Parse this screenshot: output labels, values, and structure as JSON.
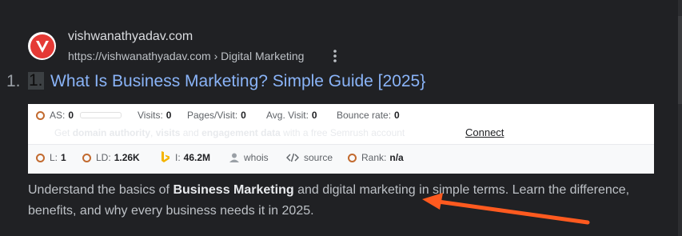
{
  "site": {
    "name": "vishwanathyadav.com",
    "url": "https://vishwanathyadav.com",
    "breadcrumb_sep": "›",
    "breadcrumb": "Digital Marketing",
    "logo_icon": "v-logo-icon",
    "more_icon": "three-dot-menu-icon"
  },
  "result": {
    "number_outer": "1.",
    "number_inner": "1.",
    "title": "What Is Business Marketing? Simple Guide [2025}"
  },
  "seo": {
    "as_label": "AS:",
    "as_value": "0",
    "visits_label": "Visits:",
    "visits_value": "0",
    "pages_label": "Pages/Visit:",
    "pages_value": "0",
    "avg_label": "Avg. Visit:",
    "avg_value": "0",
    "bounce_label": "Bounce rate:",
    "bounce_value": "0",
    "msg_pre": "Get",
    "msg_b1": "domain authority",
    "msg_mid": ",",
    "msg_b2": "visits",
    "msg_and": "and",
    "msg_b3": "engagement data",
    "msg_post": "with a free Semrush account",
    "connect": "Connect",
    "l_label": "L:",
    "l_value": "1",
    "ld_label": "LD:",
    "ld_value": "1.26K",
    "i_label": "I:",
    "i_value": "46.2M",
    "whois": "whois",
    "source": "source",
    "rank_label": "Rank:",
    "rank_value": "n/a",
    "accent": "#c26a2f"
  },
  "snippet": {
    "pre": "Understand the basics of",
    "bold": "Business Marketing",
    "post": "and digital marketing in simple terms. Learn the difference, benefits, and why every business needs it in 2025."
  },
  "annotation": {
    "arrow_color": "#ff5a1f"
  }
}
